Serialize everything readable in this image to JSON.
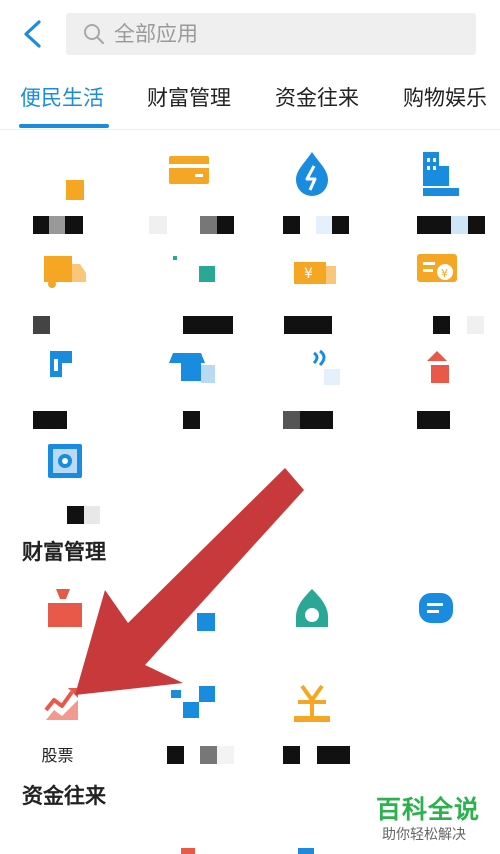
{
  "search": {
    "placeholder": "全部应用"
  },
  "tabs": [
    {
      "label": "便民生活"
    },
    {
      "label": "财富管理"
    },
    {
      "label": "资金往来"
    },
    {
      "label": "购物娱乐"
    }
  ],
  "sections": {
    "wealth_title": "财富管理",
    "funds_title": "资金往来"
  },
  "wealth": {
    "stocks_label": "股票"
  },
  "colors": {
    "accent": "#1a8ce0",
    "orange": "#f5a623",
    "teal": "#2aa795",
    "red": "#e8594a",
    "arrow": "#c8393b",
    "watermark_green": "#2bb24c"
  },
  "watermark": {
    "title": "百科全说",
    "subtitle": "助你轻松解决"
  }
}
